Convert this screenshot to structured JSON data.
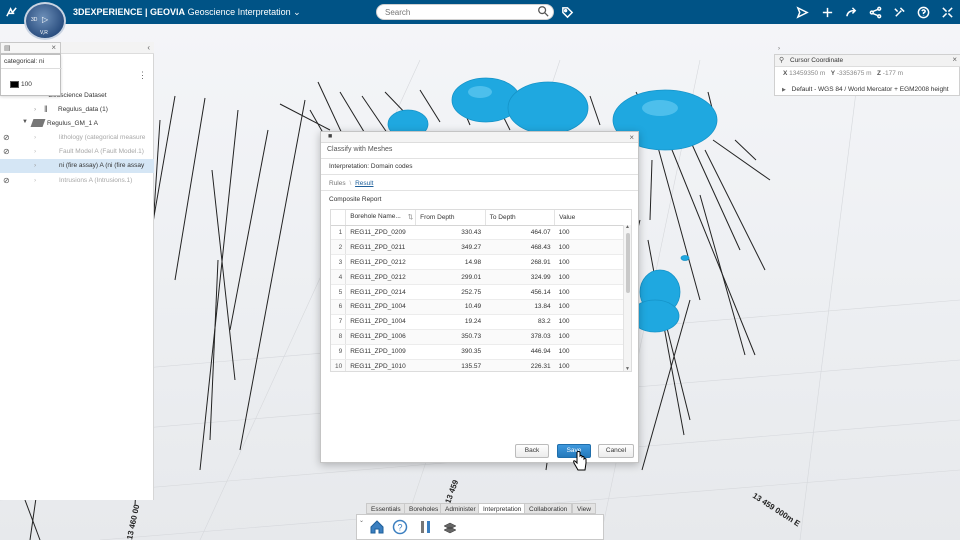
{
  "topbar": {
    "brand": "3DEXPERIENCE | GEOVIA",
    "app_name": "Geoscience Interpretation",
    "search_placeholder": "Search",
    "compass": {
      "top_label": "3D",
      "bottom_label": "V,R"
    },
    "icons": [
      "tag-icon",
      "send-icon",
      "plus-icon",
      "share-arrow-icon",
      "share-icon",
      "tools-icon",
      "help-icon",
      "fullscreen-icon"
    ]
  },
  "legend": {
    "title": "categorical: ni",
    "value": "100",
    "swatch_color": "#000000"
  },
  "tree": {
    "items": [
      {
        "label": "Geoscience Dataset",
        "dim": false,
        "selected": false
      },
      {
        "label": "Regulus_data (1)",
        "dim": false,
        "selected": false
      },
      {
        "label": "Regulus_GM_1 A",
        "dim": false,
        "selected": false
      },
      {
        "label": "lithology (categorical measure",
        "dim": true,
        "selected": false
      },
      {
        "label": "Fault Model A (Fault Model.1)",
        "dim": true,
        "selected": false
      },
      {
        "label": "ni (fire assay) A (ni (fire assay",
        "dim": false,
        "selected": true
      },
      {
        "label": "Intrusions A (Intrusions.1)",
        "dim": true,
        "selected": false
      }
    ]
  },
  "cursor_coordinate": {
    "title": "Cursor Coordinate",
    "x_label": "X",
    "x_value": "13459350 m",
    "y_label": "Y",
    "y_value": "-3353675 m",
    "z_label": "Z",
    "z_value": "-177 m",
    "crs": "Default - WGS 84 / World Mercator + EGM2008 height"
  },
  "dialog": {
    "title": "Classify with Meshes",
    "subtitle": "Interpretation: Domain codes",
    "breadcrumb_rules": "Rules",
    "breadcrumb_sep": "\\",
    "breadcrumb_result": "Result",
    "section": "Composite Report",
    "columns": [
      "Borehole Name...",
      "From Depth",
      "To Depth",
      "Value"
    ],
    "rows": [
      [
        "1",
        "REG11_ZPD_0209",
        "330.43",
        "464.07",
        "100"
      ],
      [
        "2",
        "REG11_ZPD_0211",
        "349.27",
        "468.43",
        "100"
      ],
      [
        "3",
        "REG11_ZPD_0212",
        "14.98",
        "268.91",
        "100"
      ],
      [
        "4",
        "REG11_ZPD_0212",
        "299.01",
        "324.99",
        "100"
      ],
      [
        "5",
        "REG11_ZPD_0214",
        "252.75",
        "456.14",
        "100"
      ],
      [
        "6",
        "REG11_ZPD_1004",
        "10.49",
        "13.84",
        "100"
      ],
      [
        "7",
        "REG11_ZPD_1004",
        "19.24",
        "83.2",
        "100"
      ],
      [
        "8",
        "REG11_ZPD_1006",
        "350.73",
        "378.03",
        "100"
      ],
      [
        "9",
        "REG11_ZPD_1009",
        "390.35",
        "446.94",
        "100"
      ],
      [
        "10",
        "REG11_ZPD_1010",
        "135.57",
        "226.31",
        "100"
      ]
    ],
    "back_label": "Back",
    "save_label": "Save",
    "cancel_label": "Cancel"
  },
  "bottom_toolbar": {
    "tabs": [
      "Essentials",
      "Boreholes",
      "Administer",
      "Interpretation",
      "Collaboration",
      "View"
    ],
    "active_tab": "Interpretation"
  },
  "scene_labels": {
    "label_1": "13 460 00",
    "label_2": "13 459",
    "label_3": "13 459 000m E"
  },
  "colors": {
    "topbar": "#005386",
    "mesh": "#1fa8e0",
    "accent": "#2479bb"
  }
}
